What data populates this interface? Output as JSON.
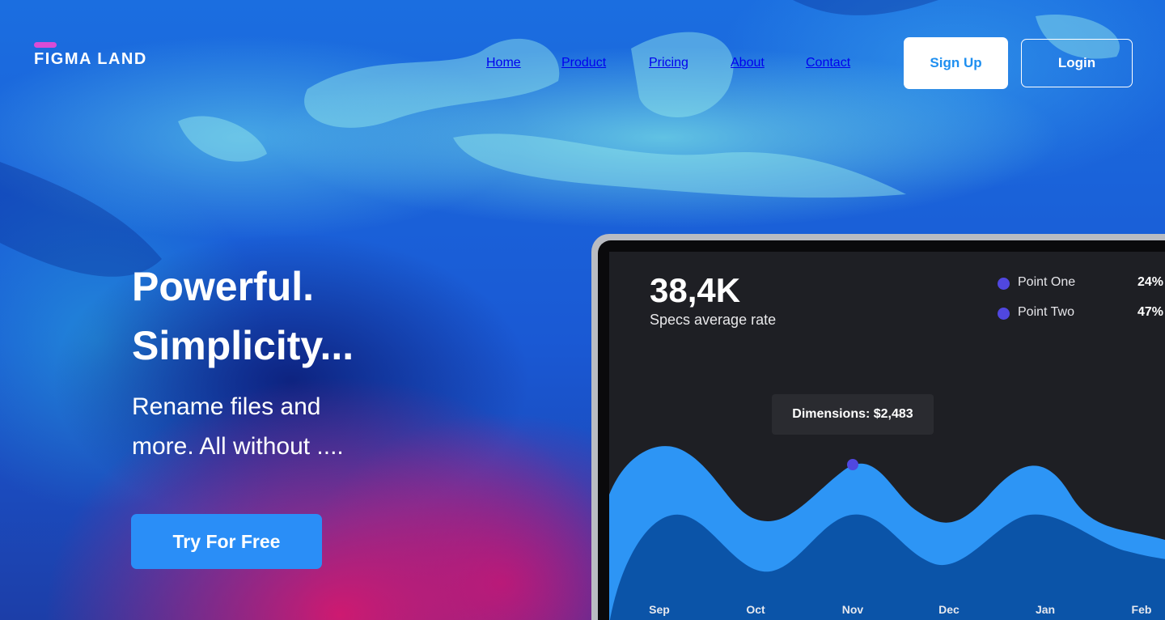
{
  "brand": {
    "name": "FIGMA LAND",
    "accent": "#d94cd6"
  },
  "nav": {
    "items": [
      {
        "label": "Home"
      },
      {
        "label": "Product"
      },
      {
        "label": "Pricing"
      },
      {
        "label": "About"
      },
      {
        "label": "Contact"
      }
    ]
  },
  "header": {
    "signup_label": "Sign Up",
    "login_label": "Login"
  },
  "hero": {
    "headline_line1": "Powerful.",
    "headline_line2": "Simplicity...",
    "subtext_line1": "Rename files and",
    "subtext_line2": "more. All without ....",
    "cta_label": "Try For Free",
    "cta_color": "#2a8ef7"
  },
  "dashboard": {
    "stat_value": "38,4K",
    "stat_label": "Specs average rate",
    "legend": [
      {
        "name": "Point One",
        "percent": "24%",
        "color": "#5047e0"
      },
      {
        "name": "Point Two",
        "percent": "47%",
        "color": "#5047e0"
      }
    ],
    "tooltip": "Dimensions: $2,483",
    "months": [
      "Sep",
      "Oct",
      "Nov",
      "Dec",
      "Jan",
      "Feb"
    ],
    "colors": {
      "light_wave": "#2d95f5",
      "dark_wave": "#0b54a8",
      "marker": "#5047e0"
    }
  }
}
